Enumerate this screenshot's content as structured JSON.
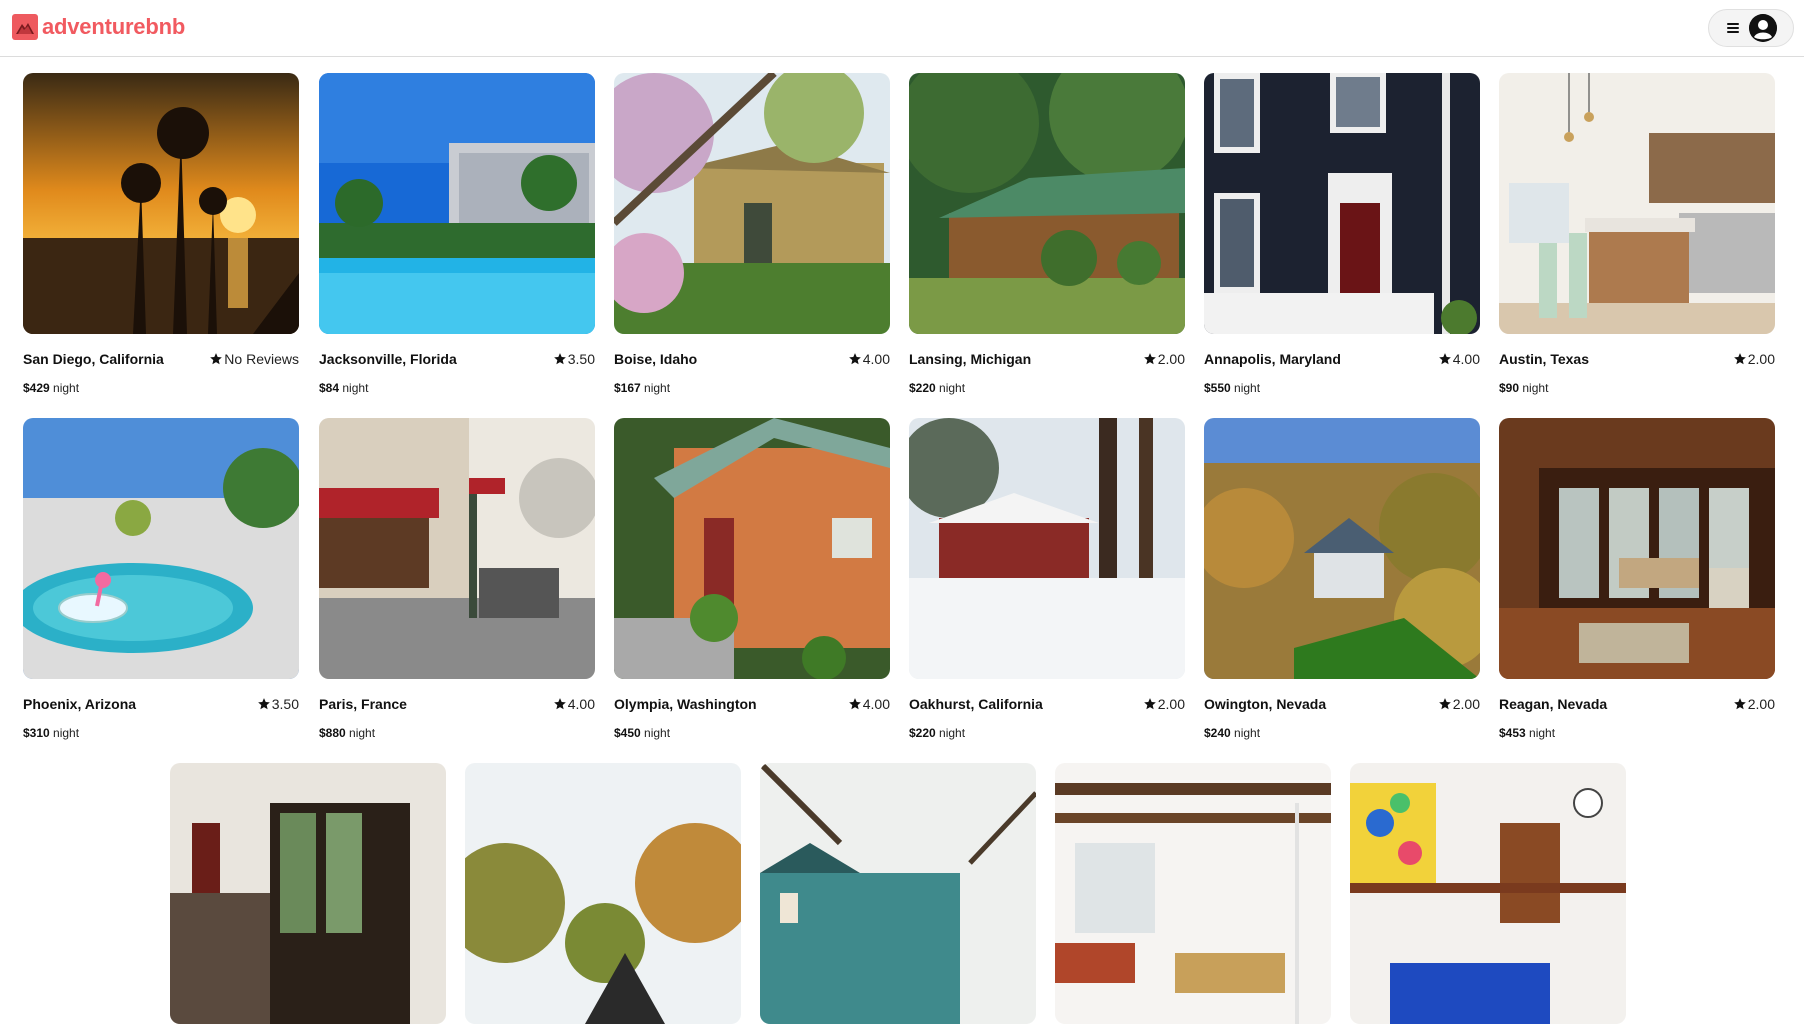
{
  "header": {
    "brand_name": "adventurebnb",
    "logo_icon": "mountain-logo-icon",
    "menu_icon": "hamburger-menu-icon",
    "avatar_icon": "user-avatar-icon"
  },
  "listings": [
    {
      "location": "San Diego, California",
      "rating": "No Reviews",
      "price": "$429",
      "unit": "night"
    },
    {
      "location": "Jacksonville, Florida",
      "rating": "3.50",
      "price": "$84",
      "unit": "night"
    },
    {
      "location": "Boise, Idaho",
      "rating": "4.00",
      "price": "$167",
      "unit": "night"
    },
    {
      "location": "Lansing, Michigan",
      "rating": "2.00",
      "price": "$220",
      "unit": "night"
    },
    {
      "location": "Annapolis, Maryland",
      "rating": "4.00",
      "price": "$550",
      "unit": "night"
    },
    {
      "location": "Austin, Texas",
      "rating": "2.00",
      "price": "$90",
      "unit": "night"
    },
    {
      "location": "Phoenix, Arizona",
      "rating": "3.50",
      "price": "$310",
      "unit": "night"
    },
    {
      "location": "Paris, France",
      "rating": "4.00",
      "price": "$880",
      "unit": "night"
    },
    {
      "location": "Olympia, Washington",
      "rating": "4.00",
      "price": "$450",
      "unit": "night"
    },
    {
      "location": "Oakhurst, California",
      "rating": "2.00",
      "price": "$220",
      "unit": "night"
    },
    {
      "location": "Owington, Nevada",
      "rating": "2.00",
      "price": "$240",
      "unit": "night"
    },
    {
      "location": "Reagan, Nevada",
      "rating": "2.00",
      "price": "$453",
      "unit": "night"
    },
    {
      "location": "",
      "rating": "",
      "price": "",
      "unit": ""
    },
    {
      "location": "",
      "rating": "",
      "price": "",
      "unit": ""
    },
    {
      "location": "",
      "rating": "",
      "price": "",
      "unit": ""
    },
    {
      "location": "",
      "rating": "",
      "price": "",
      "unit": ""
    },
    {
      "location": "",
      "rating": "",
      "price": "",
      "unit": ""
    }
  ],
  "colors": {
    "brand": "#f15a60",
    "border": "#dcdcdc"
  }
}
